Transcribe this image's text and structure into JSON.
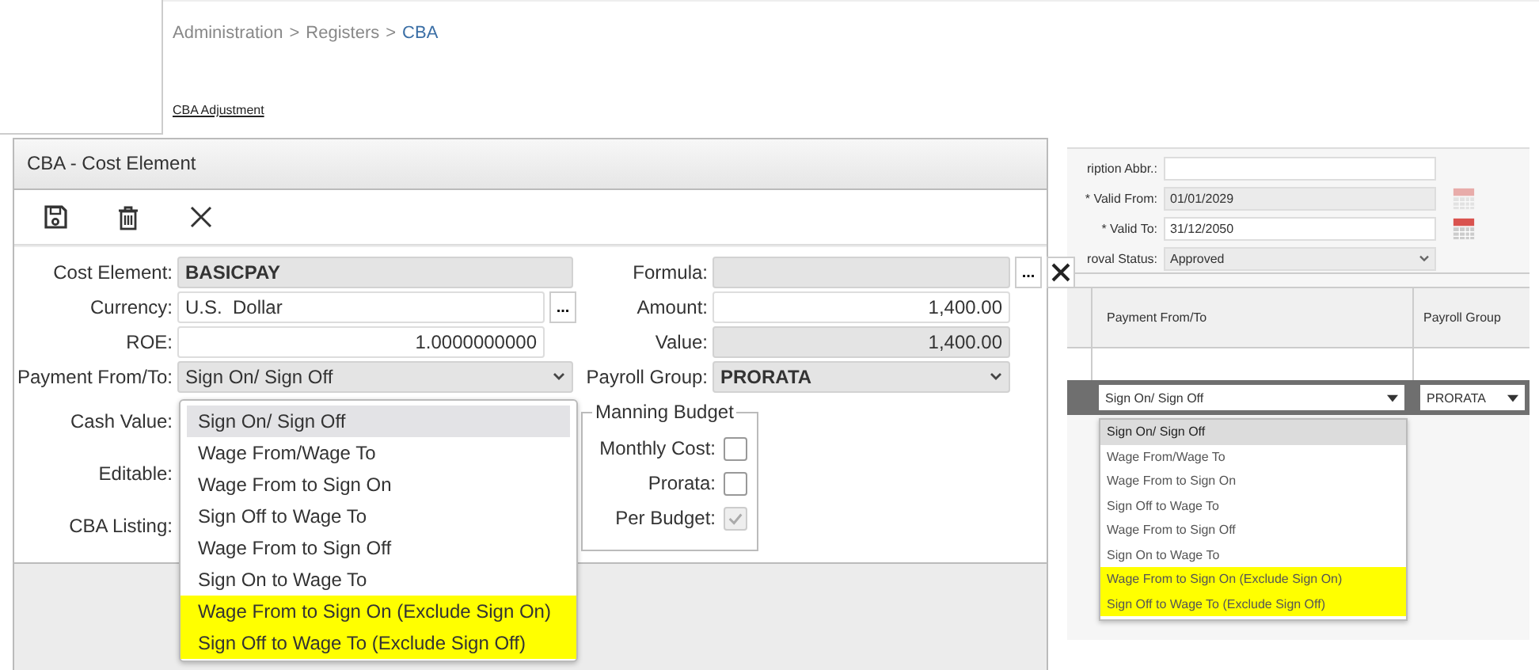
{
  "breadcrumb": {
    "separator": ">",
    "items": [
      {
        "label": "Administration",
        "current": false
      },
      {
        "label": "Registers",
        "current": false
      },
      {
        "label": "CBA",
        "current": true
      }
    ]
  },
  "page_link": "CBA Adjustment",
  "dialog": {
    "title": "CBA - Cost Element",
    "toolbar": [
      {
        "kind": "save"
      },
      {
        "kind": "delete"
      },
      {
        "kind": "close"
      }
    ],
    "left_fields": [
      {
        "kind": "text",
        "label": "Cost Element:",
        "value": "BASICPAY",
        "readonly": true
      },
      {
        "kind": "lookup",
        "label": "Currency:",
        "value": "U.S.  Dollar",
        "readonly": false,
        "button": "..."
      },
      {
        "kind": "number",
        "label": "ROE:",
        "value": "1.0000000000",
        "readonly": false
      },
      {
        "kind": "select",
        "label": "Payment From/To:",
        "value": "Sign On/ Sign Off",
        "readonly": true
      },
      {
        "kind": "label",
        "label": "Cash Value:"
      },
      {
        "kind": "label",
        "label": "Editable:"
      },
      {
        "kind": "label",
        "label": "CBA Listing:"
      }
    ],
    "right_fields": [
      {
        "kind": "lookup",
        "label": "Formula:",
        "readonly": true,
        "button": "...",
        "clear": true
      },
      {
        "kind": "number",
        "label": "Amount:",
        "value": "1,400.00",
        "readonly": false
      },
      {
        "kind": "number",
        "label": "Value:",
        "value": "1,400.00",
        "readonly": true
      },
      {
        "kind": "select",
        "label": "Payroll Group:",
        "value": "PRORATA",
        "readonly": true
      }
    ],
    "manning_budget": {
      "title": "Manning Budget",
      "checkboxes": [
        {
          "label": "Monthly Cost:",
          "checked": false,
          "disabled": false
        },
        {
          "label": "Prorata:",
          "checked": false,
          "disabled": false
        },
        {
          "label": "Per Budget:",
          "checked": true,
          "disabled": true
        }
      ]
    },
    "dropdown": {
      "options": [
        {
          "label": "Sign On/ Sign Off",
          "selected": true,
          "highlighted": false
        },
        {
          "label": "Wage From/Wage To",
          "selected": false,
          "highlighted": false
        },
        {
          "label": "Wage From to Sign On",
          "selected": false,
          "highlighted": false
        },
        {
          "label": "Sign Off to Wage To",
          "selected": false,
          "highlighted": false
        },
        {
          "label": "Wage From to Sign Off",
          "selected": false,
          "highlighted": false
        },
        {
          "label": "Sign On to Wage To",
          "selected": false,
          "highlighted": false
        },
        {
          "label": "Wage From to Sign On (Exclude Sign On)",
          "selected": false,
          "highlighted": true
        },
        {
          "label": "Sign Off to Wage To (Exclude Sign Off)",
          "selected": false,
          "highlighted": true
        }
      ]
    }
  },
  "right_panel": {
    "fields": [
      {
        "kind": "text",
        "label": "ription Abbr.:",
        "readonly": false
      },
      {
        "kind": "date",
        "label": "* Valid From:",
        "value": "01/01/2029",
        "readonly": true
      },
      {
        "kind": "date",
        "label": "* Valid To:",
        "value": "31/12/2050",
        "readonly": false
      },
      {
        "kind": "select",
        "label": "roval Status:",
        "value": "Approved",
        "readonly": true
      }
    ],
    "table": {
      "columns": [
        "Payment From/To",
        "Payroll Group"
      ],
      "edit_row": {
        "payment": "Sign On/ Sign Off",
        "payroll_group": "PRORATA"
      }
    },
    "dropdown": {
      "options": [
        {
          "label": "Sign On/ Sign Off",
          "selected": true,
          "highlighted": false
        },
        {
          "label": "Wage From/Wage To",
          "selected": false,
          "highlighted": false
        },
        {
          "label": "Wage From to Sign On",
          "selected": false,
          "highlighted": false
        },
        {
          "label": "Sign Off to Wage To",
          "selected": false,
          "highlighted": false
        },
        {
          "label": "Wage From to Sign Off",
          "selected": false,
          "highlighted": false
        },
        {
          "label": "Sign On to Wage To",
          "selected": false,
          "highlighted": false
        },
        {
          "label": "Wage From to Sign On (Exclude Sign On)",
          "selected": false,
          "highlighted": true
        },
        {
          "label": "Sign Off to Wage To (Exclude Sign Off)",
          "selected": false,
          "highlighted": true
        }
      ]
    }
  }
}
